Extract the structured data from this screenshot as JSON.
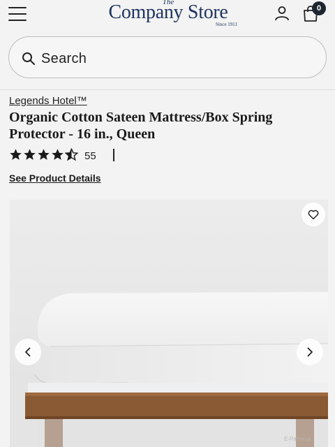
{
  "header": {
    "logo_prefix": "The",
    "logo_name": "Company Store",
    "logo_since": "Since 1911",
    "cart_count": "0",
    "brand_color": "#1f3461"
  },
  "search": {
    "placeholder": "Search"
  },
  "product": {
    "brand": "Legends Hotel™",
    "title": "Organic Cotton Sateen Mattress/Box Spring Protector - 16 in., Queen",
    "rating": 4.5,
    "rating_max": 5,
    "review_count": "55",
    "details_link": "See Product Details"
  },
  "gallery": {
    "prev_icon": "chevron-left-icon",
    "next_icon": "chevron-right-icon",
    "wishlist_icon": "heart-outline-icon",
    "watermark": "E-Pahnrua"
  }
}
